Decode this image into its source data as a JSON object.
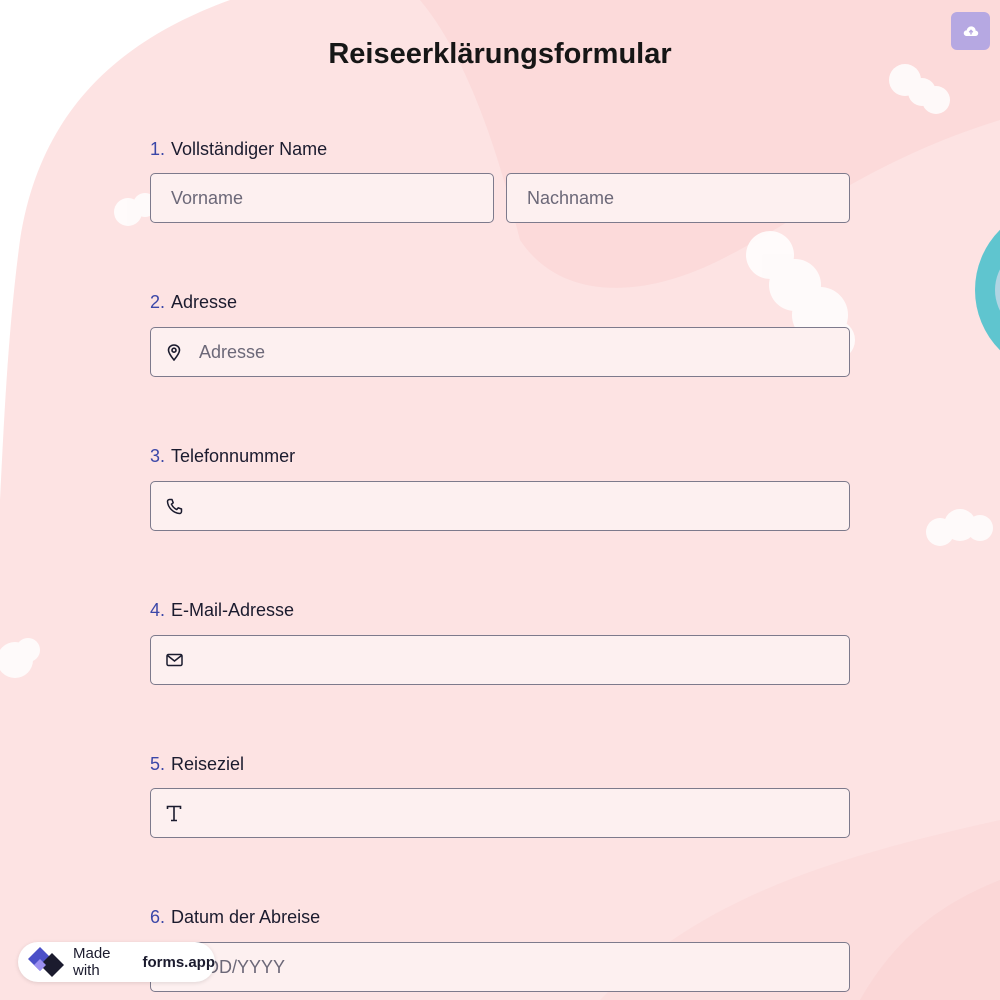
{
  "form": {
    "title": "Reiseerklärungsformular",
    "questions": [
      {
        "number": "1.",
        "label": "Vollständiger Name",
        "first_placeholder": "Vorname",
        "last_placeholder": "Nachname"
      },
      {
        "number": "2.",
        "label": "Adresse",
        "placeholder": "Adresse",
        "icon": "map-pin-icon"
      },
      {
        "number": "3.",
        "label": "Telefonnummer",
        "placeholder": "",
        "icon": "phone-icon"
      },
      {
        "number": "4.",
        "label": "E-Mail-Adresse",
        "placeholder": "",
        "icon": "envelope-icon"
      },
      {
        "number": "5.",
        "label": "Reiseziel",
        "placeholder": "",
        "icon": "text-type-icon"
      },
      {
        "number": "6.",
        "label": "Datum der Abreise",
        "placeholder": "MM/DD/YYYY"
      }
    ]
  },
  "save_button": {
    "icon": "cloud-upload-icon"
  },
  "badge": {
    "prefix": "Made with",
    "brand": "forms.app"
  },
  "colors": {
    "background": "#fde3e3",
    "accent": "#3b47a8",
    "save_button": "#b6a8e2",
    "input_bg": "#fdf0f0"
  }
}
